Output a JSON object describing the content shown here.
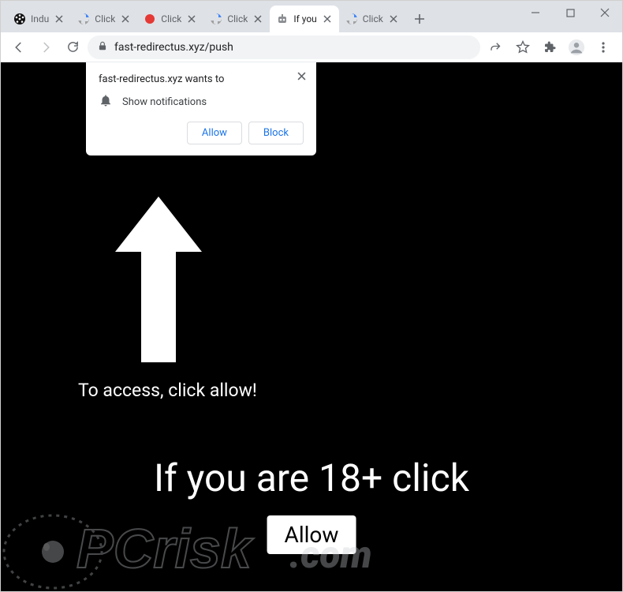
{
  "tabs": [
    {
      "title": "Indu",
      "icon": "reel"
    },
    {
      "title": "Click",
      "icon": "recaptcha"
    },
    {
      "title": "Click",
      "icon": "red-dot"
    },
    {
      "title": "Click",
      "icon": "recaptcha"
    },
    {
      "title": "If you",
      "icon": "robot",
      "active": true
    },
    {
      "title": "Click",
      "icon": "recaptcha"
    }
  ],
  "omnibox": {
    "url": "fast-redirectus.xyz/push"
  },
  "permission": {
    "host_wants": "fast-redirectus.xyz wants to",
    "line": "Show notifications",
    "allow": "Allow",
    "block": "Block"
  },
  "page": {
    "access_text": "To access, click allow!",
    "headline": "If you are 18+ click",
    "allow_button": "Allow"
  },
  "watermark": {
    "text": "PCrisk.com"
  }
}
